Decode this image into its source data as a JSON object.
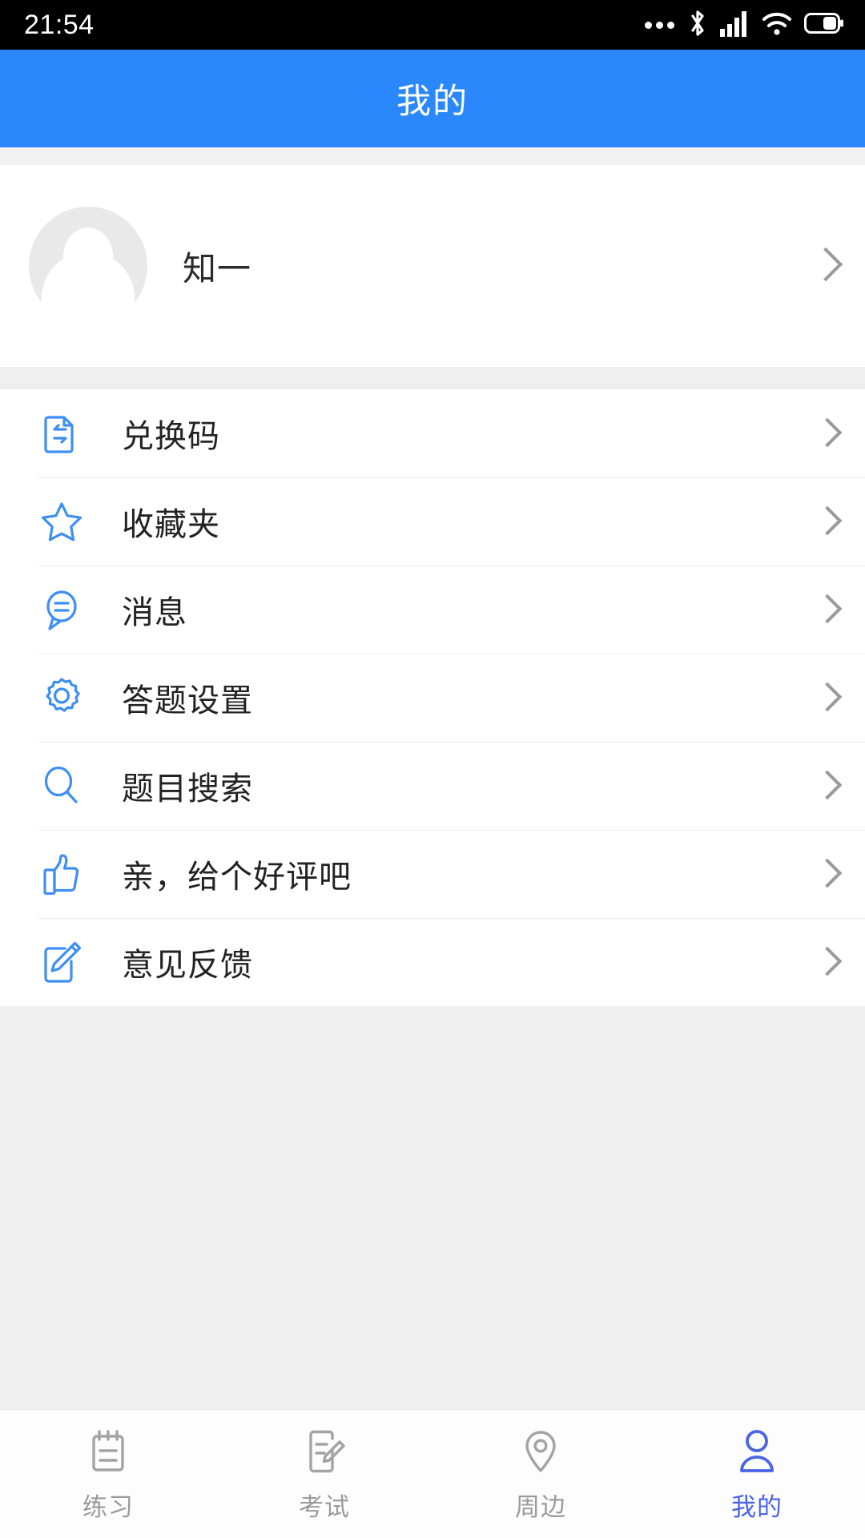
{
  "status_bar": {
    "time": "21:54",
    "icons": [
      "more-dots-icon",
      "bluetooth-icon",
      "cellular-signal-icon",
      "wifi-icon",
      "battery-icon"
    ]
  },
  "header": {
    "title": "我的",
    "background_color": "#2b88fc",
    "title_color": "#ffffff"
  },
  "profile": {
    "name": "知一",
    "avatar_icon": "default-user-avatar-icon",
    "chevron_icon": "chevron-right-icon"
  },
  "menu": {
    "items": [
      {
        "label": "兑换码",
        "icon": "redeem-code-icon",
        "chevron": "chevron-right-icon"
      },
      {
        "label": "收藏夹",
        "icon": "star-favorites-icon",
        "chevron": "chevron-right-icon"
      },
      {
        "label": "消息",
        "icon": "message-bubble-icon",
        "chevron": "chevron-right-icon"
      },
      {
        "label": "答题设置",
        "icon": "gear-settings-icon",
        "chevron": "chevron-right-icon"
      },
      {
        "label": "题目搜索",
        "icon": "search-icon",
        "chevron": "chevron-right-icon"
      },
      {
        "label": "亲，给个好评吧",
        "icon": "thumbs-up-icon",
        "chevron": "chevron-right-icon"
      },
      {
        "label": "意见反馈",
        "icon": "edit-pencil-icon",
        "chevron": "chevron-right-icon"
      }
    ],
    "icon_color": "#3d8ef5",
    "divider_color": "#ebebeb"
  },
  "tab_bar": {
    "active_index": 3,
    "active_color": "#4a63e7",
    "inactive_color": "#9b9b9b",
    "items": [
      {
        "label": "练习",
        "icon": "notebook-icon"
      },
      {
        "label": "考试",
        "icon": "exam-paper-pencil-icon"
      },
      {
        "label": "周边",
        "icon": "location-pin-icon"
      },
      {
        "label": "我的",
        "icon": "person-icon"
      }
    ]
  }
}
